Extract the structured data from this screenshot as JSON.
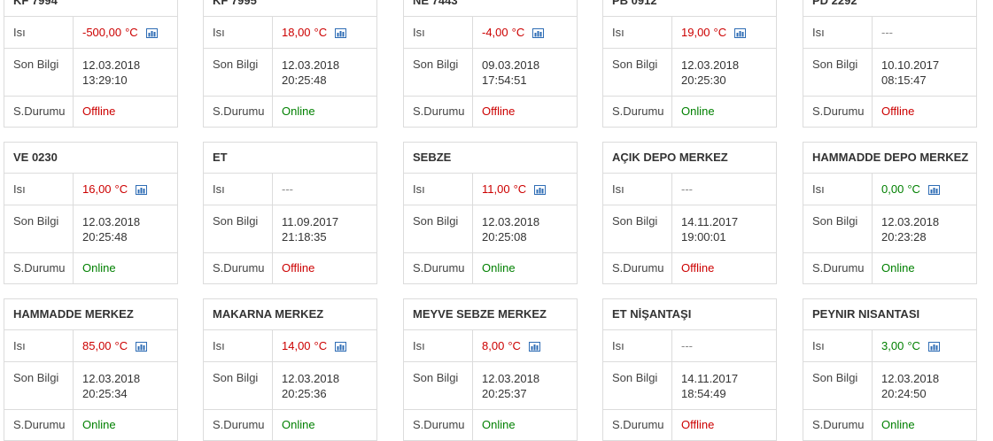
{
  "labels": {
    "isi": "Isı",
    "son_bilgi": "Son Bilgi",
    "durum": "S.Durumu"
  },
  "colors": {
    "offline": "#cc0000",
    "online": "#008000",
    "chart_icon": "#2f6db5"
  },
  "cards": [
    {
      "title": "KF 7994",
      "temp": "-500,00",
      "unit": "°C",
      "temp_color": "red",
      "date": "12.03.2018",
      "time": "13:29:10",
      "status": "Offline",
      "chart": true
    },
    {
      "title": "KF 7995",
      "temp": "18,00",
      "unit": "°C",
      "temp_color": "red",
      "date": "12.03.2018",
      "time": "20:25:48",
      "status": "Online",
      "chart": true
    },
    {
      "title": "NE 7443",
      "temp": "-4,00",
      "unit": "°C",
      "temp_color": "red",
      "date": "09.03.2018",
      "time": "17:54:51",
      "status": "Offline",
      "chart": true
    },
    {
      "title": "PB 0912",
      "temp": "19,00",
      "unit": "°C",
      "temp_color": "red",
      "date": "12.03.2018",
      "time": "20:25:30",
      "status": "Online",
      "chart": true
    },
    {
      "title": "PD 2292",
      "temp": "---",
      "unit": "",
      "temp_color": "muted",
      "date": "10.10.2017",
      "time": "08:15:47",
      "status": "Offline",
      "chart": false
    },
    {
      "title": "VE 0230",
      "temp": "16,00",
      "unit": "°C",
      "temp_color": "red",
      "date": "12.03.2018",
      "time": "20:25:48",
      "status": "Online",
      "chart": true
    },
    {
      "title": "ET",
      "temp": "---",
      "unit": "",
      "temp_color": "muted",
      "date": "11.09.2017",
      "time": "21:18:35",
      "status": "Offline",
      "chart": false
    },
    {
      "title": "SEBZE",
      "temp": "11,00",
      "unit": "°C",
      "temp_color": "red",
      "date": "12.03.2018",
      "time": "20:25:08",
      "status": "Online",
      "chart": true
    },
    {
      "title": "AÇIK DEPO MERKEZ",
      "temp": "---",
      "unit": "",
      "temp_color": "muted",
      "date": "14.11.2017",
      "time": "19:00:01",
      "status": "Offline",
      "chart": false
    },
    {
      "title": "HAMMADDE DEPO MERKEZ",
      "temp": "0,00",
      "unit": "°C",
      "temp_color": "green",
      "date": "12.03.2018",
      "time": "20:23:28",
      "status": "Online",
      "chart": true
    },
    {
      "title": "HAMMADDE MERKEZ",
      "temp": "85,00",
      "unit": "°C",
      "temp_color": "red",
      "date": "12.03.2018",
      "time": "20:25:34",
      "status": "Online",
      "chart": true
    },
    {
      "title": "MAKARNA MERKEZ",
      "temp": "14,00",
      "unit": "°C",
      "temp_color": "red",
      "date": "12.03.2018",
      "time": "20:25:36",
      "status": "Online",
      "chart": true
    },
    {
      "title": "MEYVE SEBZE MERKEZ",
      "temp": "8,00",
      "unit": "°C",
      "temp_color": "red",
      "date": "12.03.2018",
      "time": "20:25:37",
      "status": "Online",
      "chart": true
    },
    {
      "title": "ET NİŞANTAŞI",
      "temp": "---",
      "unit": "",
      "temp_color": "muted",
      "date": "14.11.2017",
      "time": "18:54:49",
      "status": "Offline",
      "chart": false
    },
    {
      "title": "PEYNIR NISANTASI",
      "temp": "3,00",
      "unit": "°C",
      "temp_color": "green",
      "date": "12.03.2018",
      "time": "20:24:50",
      "status": "Online",
      "chart": true
    }
  ]
}
